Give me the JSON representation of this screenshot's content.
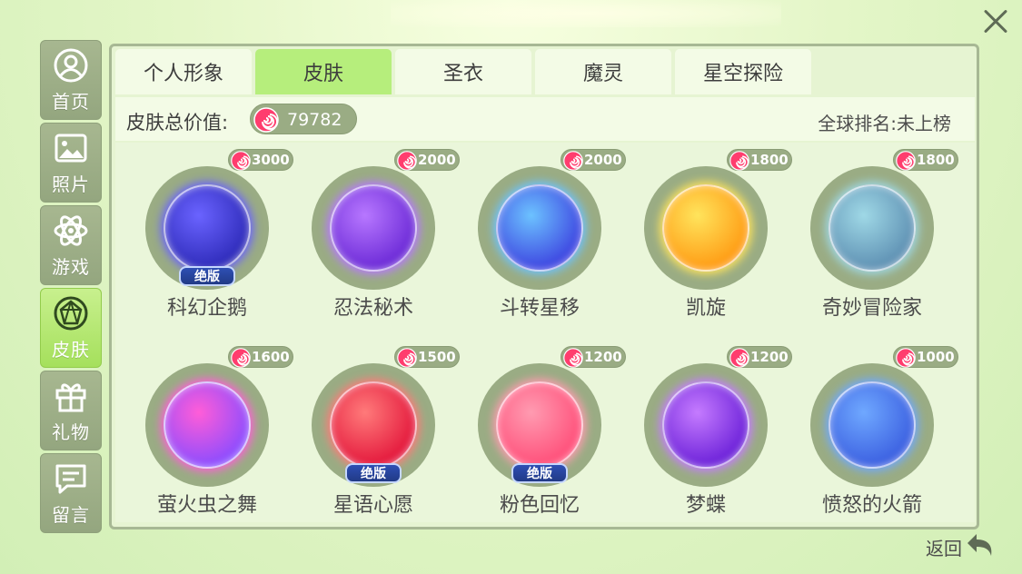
{
  "sidebar": {
    "items": [
      {
        "label": "首页",
        "icon": "user-icon"
      },
      {
        "label": "照片",
        "icon": "photo-icon"
      },
      {
        "label": "游戏",
        "icon": "atom-icon"
      },
      {
        "label": "皮肤",
        "icon": "diamond-icon",
        "active": true
      },
      {
        "label": "礼物",
        "icon": "gift-icon"
      },
      {
        "label": "留言",
        "icon": "message-icon"
      }
    ]
  },
  "tabs": [
    {
      "label": "个人形象"
    },
    {
      "label": "皮肤",
      "active": true
    },
    {
      "label": "圣衣"
    },
    {
      "label": "魔灵"
    },
    {
      "label": "星空探险"
    }
  ],
  "summary": {
    "total_label": "皮肤总价值:",
    "total_value": "79782",
    "rank_text": "全球排名:未上榜"
  },
  "skins": [
    {
      "name": "科幻企鹅",
      "price": "3000",
      "badge": "绝版",
      "colors": [
        "#6a63ff",
        "#2d2ab8"
      ]
    },
    {
      "name": "忍法秘术",
      "price": "2000",
      "badge": "",
      "colors": [
        "#b777ff",
        "#6a28d6"
      ]
    },
    {
      "name": "斗转星移",
      "price": "2000",
      "badge": "",
      "colors": [
        "#6cc2ff",
        "#3c42e0"
      ]
    },
    {
      "name": "凯旋",
      "price": "1800",
      "badge": "",
      "colors": [
        "#ffe45c",
        "#ff9a12"
      ]
    },
    {
      "name": "奇妙冒险家",
      "price": "1800",
      "badge": "",
      "colors": [
        "#9fd8e6",
        "#5d8fb2"
      ]
    },
    {
      "name": "萤火虫之舞",
      "price": "1600",
      "badge": "",
      "colors": [
        "#ff5dd8",
        "#8a4cff"
      ]
    },
    {
      "name": "星语心愿",
      "price": "1500",
      "badge": "绝版",
      "colors": [
        "#ff7a7a",
        "#e3153a"
      ]
    },
    {
      "name": "粉色回忆",
      "price": "1200",
      "badge": "绝版",
      "colors": [
        "#ff9bb1",
        "#ff4d78"
      ]
    },
    {
      "name": "梦蝶",
      "price": "1200",
      "badge": "",
      "colors": [
        "#c57bff",
        "#6a1fd8"
      ]
    },
    {
      "name": "愤怒的火箭",
      "price": "1000",
      "badge": "",
      "colors": [
        "#6fa8ff",
        "#3a5ee0"
      ]
    }
  ],
  "back_label": "返回",
  "colors": {
    "accent_green": "#b6ee7c",
    "nav_gray": "#9aac84",
    "coin_pink": "#ff3d6e"
  }
}
